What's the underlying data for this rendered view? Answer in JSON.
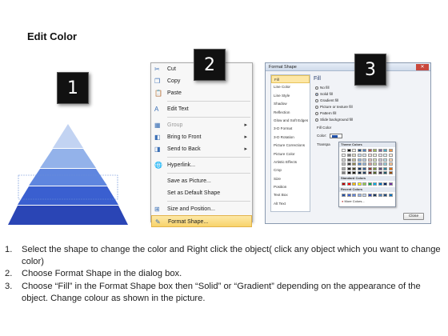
{
  "title": "Edit Color",
  "badges": [
    "1",
    "2",
    "3"
  ],
  "pyramid": {
    "colors": [
      "#c2d3f2",
      "#93b2ea",
      "#5f86df",
      "#3a5fd0",
      "#2a45b5"
    ]
  },
  "menu": {
    "items": [
      {
        "label": "Cut",
        "icon": "scissors-icon",
        "glyph": "✂",
        "disabled": false
      },
      {
        "label": "Copy",
        "icon": "copy-icon",
        "glyph": "❐",
        "disabled": false
      },
      {
        "label": "Paste",
        "icon": "paste-icon",
        "glyph": "📋",
        "disabled": false
      },
      {
        "label": "Edit Text",
        "icon": "edit-text-icon",
        "glyph": "A",
        "disabled": false
      },
      {
        "label": "Group",
        "icon": "group-icon",
        "glyph": "▦",
        "disabled": true,
        "submenu": true
      },
      {
        "label": "Bring to Front",
        "icon": "bring-front-icon",
        "glyph": "◧",
        "disabled": false,
        "submenu": true
      },
      {
        "label": "Send to Back",
        "icon": "send-back-icon",
        "glyph": "◨",
        "disabled": false,
        "submenu": true
      },
      {
        "label": "Hyperlink...",
        "icon": "hyperlink-icon",
        "glyph": "🌐",
        "disabled": false
      },
      {
        "label": "Save as Picture...",
        "icon": "",
        "glyph": "",
        "disabled": false
      },
      {
        "label": "Set as Default Shape",
        "icon": "",
        "glyph": "",
        "disabled": false
      },
      {
        "label": "Size and Position...",
        "icon": "size-position-icon",
        "glyph": "⊞",
        "disabled": false
      },
      {
        "label": "Format Shape...",
        "icon": "format-shape-icon",
        "glyph": "✎",
        "disabled": false,
        "highlighted": true
      }
    ]
  },
  "dialog": {
    "title": "Format Shape",
    "nav": [
      "Fill",
      "Line Color",
      "Line Style",
      "Shadow",
      "Reflection",
      "Glow and Soft Edges",
      "3-D Format",
      "3-D Rotation",
      "Picture Corrections",
      "Picture Color",
      "Artistic Effects",
      "Crop",
      "Size",
      "Position",
      "Text Box",
      "Alt Text"
    ],
    "fill_heading": "Fill",
    "options": [
      "No fill",
      "Solid fill",
      "Gradient fill",
      "Picture or texture fill",
      "Pattern fill",
      "Slide background fill"
    ],
    "selected_option": 1,
    "fill_color_label": "Fill Color",
    "color_label": "Color:",
    "transparency_label": "Transpa",
    "palette": {
      "theme_heading": "Theme Colors",
      "standard_heading": "Standard Colors",
      "recent_heading": "Recent Colors",
      "more_label": "More Colors...",
      "theme_top": [
        "#ffffff",
        "#000000",
        "#eeece1",
        "#1f497d",
        "#4f81bd",
        "#c0504d",
        "#9bbb59",
        "#8064a2",
        "#4bacc6",
        "#f79646"
      ],
      "theme_shades": [
        [
          "#f2f2f2",
          "#7f7f7f",
          "#ddd9c3",
          "#c6d9f0",
          "#dbe5f1",
          "#f2dcdb",
          "#ebf1dd",
          "#e5e0ec",
          "#dbeef3",
          "#fdeada"
        ],
        [
          "#d8d8d8",
          "#595959",
          "#c4bd97",
          "#8db3e2",
          "#b8cce4",
          "#e5b9b7",
          "#d7e3bc",
          "#ccc1d9",
          "#b7dde8",
          "#fbd5b5"
        ],
        [
          "#bfbfbf",
          "#3f3f3f",
          "#938953",
          "#548dd4",
          "#95b3d7",
          "#d99694",
          "#c3d69b",
          "#b2a2c7",
          "#92cddc",
          "#fac08f"
        ],
        [
          "#a5a5a5",
          "#262626",
          "#494429",
          "#17365d",
          "#366092",
          "#953734",
          "#76923c",
          "#5f497a",
          "#31859b",
          "#e36c09"
        ],
        [
          "#7f7f7f",
          "#0c0c0c",
          "#1d1b10",
          "#0f243e",
          "#244061",
          "#632423",
          "#4f6128",
          "#3f3151",
          "#205867",
          "#974806"
        ]
      ],
      "standard": [
        "#c00000",
        "#ff0000",
        "#ffc000",
        "#ffff00",
        "#92d050",
        "#00b050",
        "#00b0f0",
        "#0070c0",
        "#002060",
        "#7030a0"
      ],
      "recent": [
        "#1f4fa8",
        "#3a5fd0",
        "#5f86df",
        "#93b2ea",
        "#c2d3f2",
        "#2a45b5",
        "#17365d",
        "#4f81bd",
        "#1f497d",
        "#0070c0"
      ]
    },
    "close_label": "Close"
  },
  "steps": [
    {
      "num": "1.",
      "text": "Select the shape to change the color and Right click the object( click any object which you want to change color)"
    },
    {
      "num": "2.",
      "text": "Choose Format Shape in the dialog box."
    },
    {
      "num": "3.",
      "text": "Choose “Fill” in the Format Shape box then “Solid” or “Gradient” depending on the appearance of the object. Change colour as shown in the picture."
    }
  ]
}
